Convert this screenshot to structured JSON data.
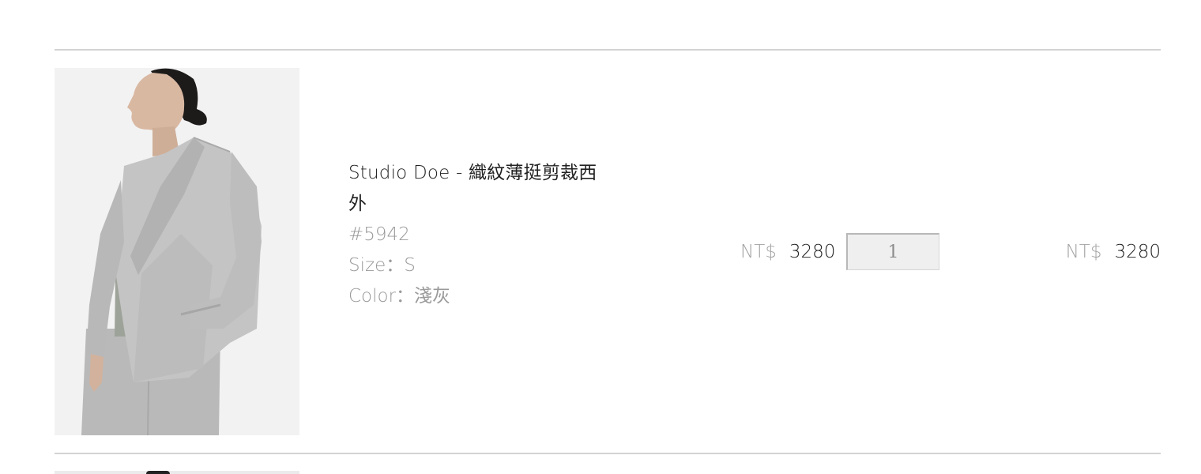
{
  "cart_item": {
    "title": "Studio Doe - 織紋薄挺剪裁西外",
    "sku": "#5942",
    "size_text": "Size：S",
    "color_text": "Color：淺灰",
    "unit_price": {
      "currency": "NT$",
      "amount": "3280"
    },
    "quantity": "1",
    "line_total": {
      "currency": "NT$",
      "amount": "3280"
    }
  },
  "colors": {
    "divider": "#d3d3d3",
    "muted_text": "#9a9a9a",
    "quantity_bg": "#efefef"
  }
}
